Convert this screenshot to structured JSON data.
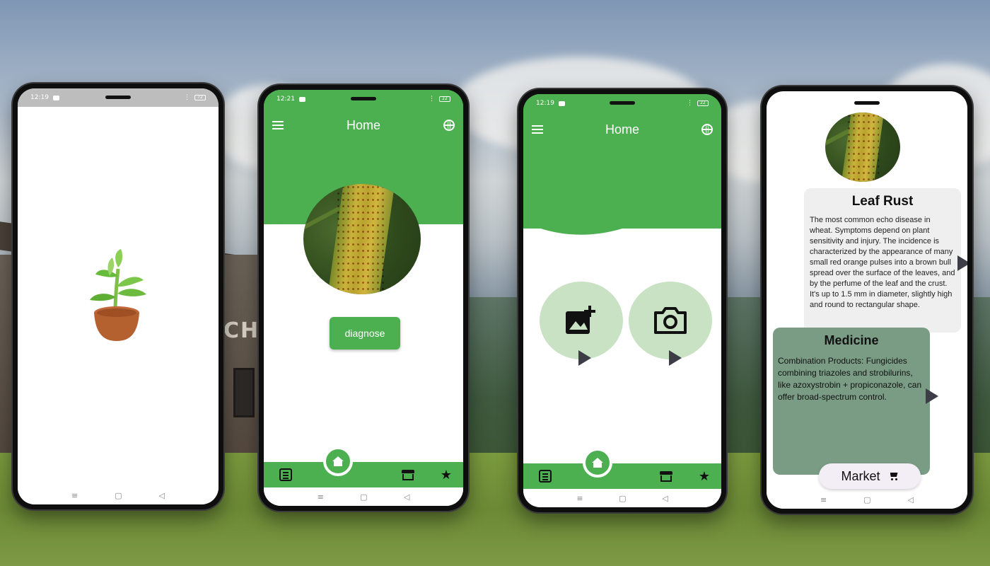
{
  "phone1": {
    "status": {
      "time": "12:19",
      "battery": "72"
    },
    "logo": "potted-plant-logo"
  },
  "phone2": {
    "status": {
      "time": "12:21",
      "battery": "22"
    },
    "header": {
      "title": "Home"
    },
    "diagnose_label": "diagnose",
    "bottom_nav": [
      "articles",
      "home",
      "market",
      "favorites"
    ]
  },
  "phone3": {
    "status": {
      "time": "12:19",
      "battery": "22"
    },
    "header": {
      "title": "Home"
    },
    "actions": [
      "gallery",
      "camera"
    ]
  },
  "phone4": {
    "disease": {
      "title": "Leaf Rust",
      "description": "The most common echo disease in wheat. Symptoms depend on plant sensitivity and injury. The incidence is characterized by the appearance of many small red orange pulses into a brown bull spread over the surface of the leaves, and by the perfume of the leaf and the crust. It's up to 1.5 mm in diameter, slightly high and round to rectangular shape."
    },
    "medicine": {
      "title": "Medicine",
      "description": "Combination Products: Fungicides combining triazoles and strobilurins, like azoxystrobin + propiconazole, can offer broad-spectrum control."
    },
    "market_label": "Market"
  },
  "colors": {
    "primary_green": "#4caf50",
    "light_green": "#c8e2c3",
    "medicine_card": "#7a9c84",
    "rust_card": "#efefef"
  }
}
